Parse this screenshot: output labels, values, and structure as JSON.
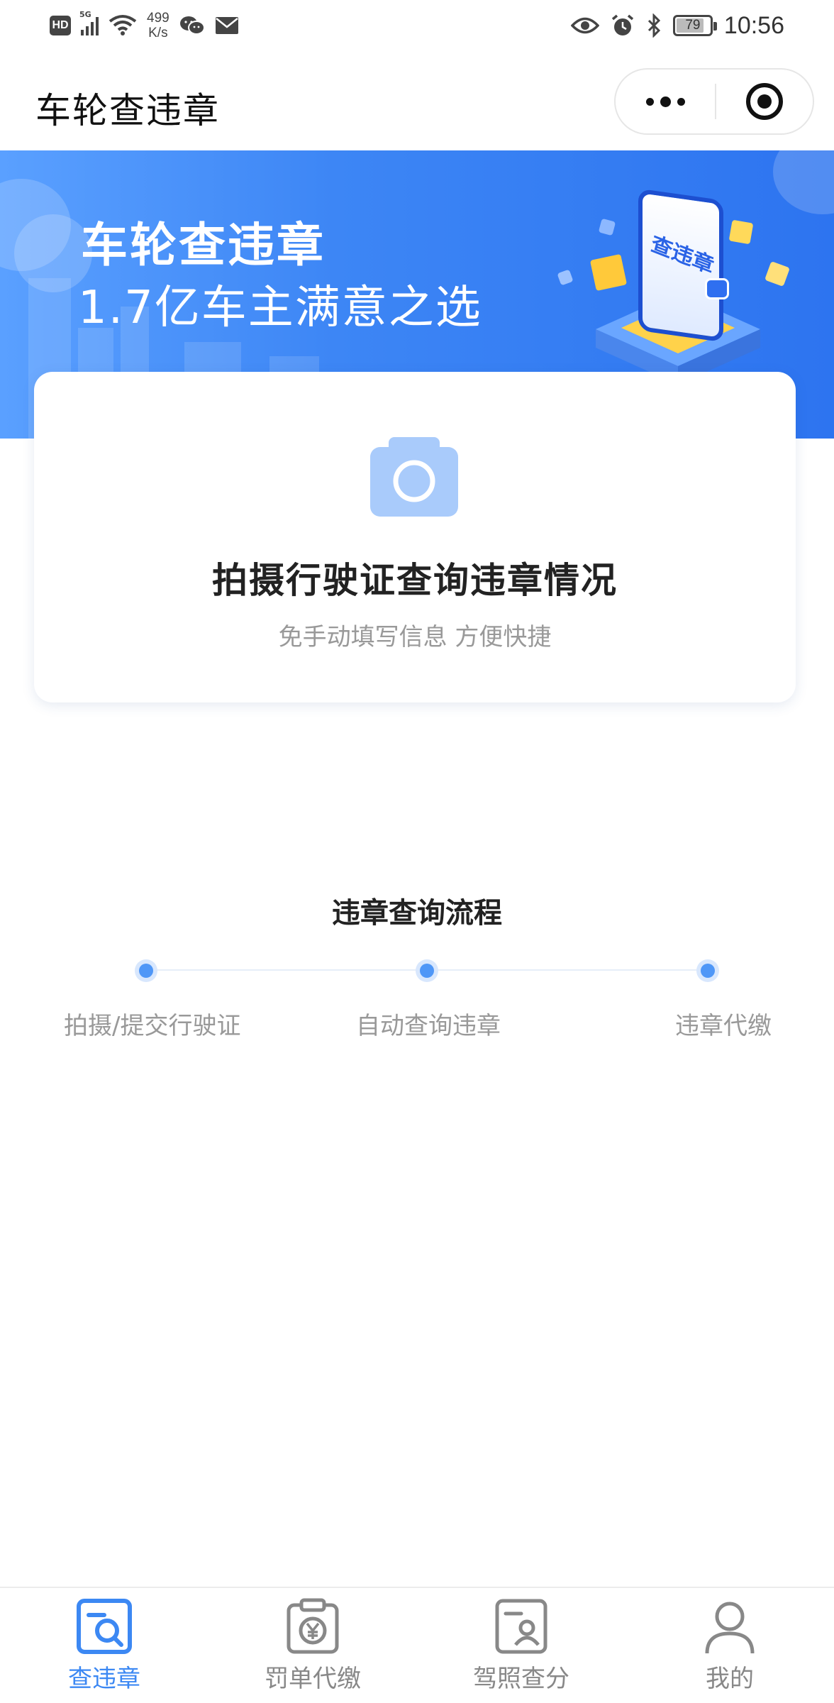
{
  "status_bar": {
    "hd": "HD",
    "network": "5G",
    "speed_value": "499",
    "speed_unit": "K/s",
    "battery": "79",
    "time": "10:56"
  },
  "nav": {
    "title": "车轮查违章",
    "icons": [
      "more-icon",
      "close-target-icon"
    ]
  },
  "banner": {
    "title": "车轮查违章",
    "subtitle": "1.7亿车主满意之选",
    "phone_label": "查违章"
  },
  "scan_card": {
    "title": "拍摄行驶证查询违章情况",
    "subtitle": "免手动填写信息 方便快捷",
    "icon": "camera-icon"
  },
  "process": {
    "title": "违章查询流程",
    "steps": [
      {
        "label": "拍摄/提交行驶证"
      },
      {
        "label": "自动查询违章"
      },
      {
        "label": "违章代缴"
      }
    ]
  },
  "tabs": [
    {
      "label": "查违章",
      "icon": "search-doc-icon",
      "active": true
    },
    {
      "label": "罚单代缴",
      "icon": "clipboard-yen-icon",
      "active": false
    },
    {
      "label": "驾照查分",
      "icon": "license-card-icon",
      "active": false
    },
    {
      "label": "我的",
      "icon": "person-icon",
      "active": false
    }
  ],
  "colors": {
    "accent": "#3c88f3",
    "banner_start": "#5aa0ff",
    "banner_end": "#2d74f0",
    "camera": "#a9cbfb",
    "muted_text": "#999999"
  }
}
